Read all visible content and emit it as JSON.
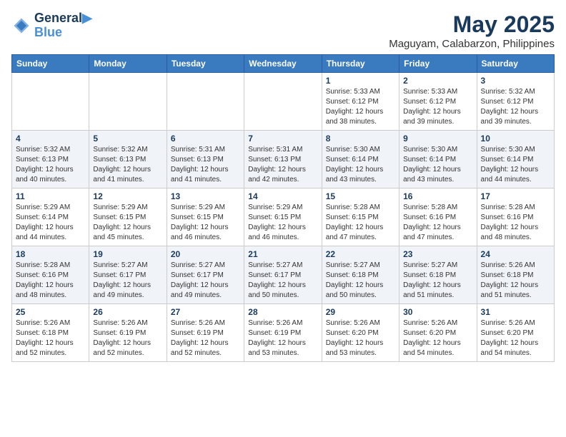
{
  "header": {
    "logo_line1": "General",
    "logo_line2": "Blue",
    "title": "May 2025",
    "subtitle": "Maguyam, Calabarzon, Philippines"
  },
  "columns": [
    "Sunday",
    "Monday",
    "Tuesday",
    "Wednesday",
    "Thursday",
    "Friday",
    "Saturday"
  ],
  "weeks": [
    [
      {
        "day": "",
        "info": ""
      },
      {
        "day": "",
        "info": ""
      },
      {
        "day": "",
        "info": ""
      },
      {
        "day": "",
        "info": ""
      },
      {
        "day": "1",
        "info": "Sunrise: 5:33 AM\nSunset: 6:12 PM\nDaylight: 12 hours\nand 38 minutes."
      },
      {
        "day": "2",
        "info": "Sunrise: 5:33 AM\nSunset: 6:12 PM\nDaylight: 12 hours\nand 39 minutes."
      },
      {
        "day": "3",
        "info": "Sunrise: 5:32 AM\nSunset: 6:12 PM\nDaylight: 12 hours\nand 39 minutes."
      }
    ],
    [
      {
        "day": "4",
        "info": "Sunrise: 5:32 AM\nSunset: 6:13 PM\nDaylight: 12 hours\nand 40 minutes."
      },
      {
        "day": "5",
        "info": "Sunrise: 5:32 AM\nSunset: 6:13 PM\nDaylight: 12 hours\nand 41 minutes."
      },
      {
        "day": "6",
        "info": "Sunrise: 5:31 AM\nSunset: 6:13 PM\nDaylight: 12 hours\nand 41 minutes."
      },
      {
        "day": "7",
        "info": "Sunrise: 5:31 AM\nSunset: 6:13 PM\nDaylight: 12 hours\nand 42 minutes."
      },
      {
        "day": "8",
        "info": "Sunrise: 5:30 AM\nSunset: 6:14 PM\nDaylight: 12 hours\nand 43 minutes."
      },
      {
        "day": "9",
        "info": "Sunrise: 5:30 AM\nSunset: 6:14 PM\nDaylight: 12 hours\nand 43 minutes."
      },
      {
        "day": "10",
        "info": "Sunrise: 5:30 AM\nSunset: 6:14 PM\nDaylight: 12 hours\nand 44 minutes."
      }
    ],
    [
      {
        "day": "11",
        "info": "Sunrise: 5:29 AM\nSunset: 6:14 PM\nDaylight: 12 hours\nand 44 minutes."
      },
      {
        "day": "12",
        "info": "Sunrise: 5:29 AM\nSunset: 6:15 PM\nDaylight: 12 hours\nand 45 minutes."
      },
      {
        "day": "13",
        "info": "Sunrise: 5:29 AM\nSunset: 6:15 PM\nDaylight: 12 hours\nand 46 minutes."
      },
      {
        "day": "14",
        "info": "Sunrise: 5:29 AM\nSunset: 6:15 PM\nDaylight: 12 hours\nand 46 minutes."
      },
      {
        "day": "15",
        "info": "Sunrise: 5:28 AM\nSunset: 6:15 PM\nDaylight: 12 hours\nand 47 minutes."
      },
      {
        "day": "16",
        "info": "Sunrise: 5:28 AM\nSunset: 6:16 PM\nDaylight: 12 hours\nand 47 minutes."
      },
      {
        "day": "17",
        "info": "Sunrise: 5:28 AM\nSunset: 6:16 PM\nDaylight: 12 hours\nand 48 minutes."
      }
    ],
    [
      {
        "day": "18",
        "info": "Sunrise: 5:28 AM\nSunset: 6:16 PM\nDaylight: 12 hours\nand 48 minutes."
      },
      {
        "day": "19",
        "info": "Sunrise: 5:27 AM\nSunset: 6:17 PM\nDaylight: 12 hours\nand 49 minutes."
      },
      {
        "day": "20",
        "info": "Sunrise: 5:27 AM\nSunset: 6:17 PM\nDaylight: 12 hours\nand 49 minutes."
      },
      {
        "day": "21",
        "info": "Sunrise: 5:27 AM\nSunset: 6:17 PM\nDaylight: 12 hours\nand 50 minutes."
      },
      {
        "day": "22",
        "info": "Sunrise: 5:27 AM\nSunset: 6:18 PM\nDaylight: 12 hours\nand 50 minutes."
      },
      {
        "day": "23",
        "info": "Sunrise: 5:27 AM\nSunset: 6:18 PM\nDaylight: 12 hours\nand 51 minutes."
      },
      {
        "day": "24",
        "info": "Sunrise: 5:26 AM\nSunset: 6:18 PM\nDaylight: 12 hours\nand 51 minutes."
      }
    ],
    [
      {
        "day": "25",
        "info": "Sunrise: 5:26 AM\nSunset: 6:18 PM\nDaylight: 12 hours\nand 52 minutes."
      },
      {
        "day": "26",
        "info": "Sunrise: 5:26 AM\nSunset: 6:19 PM\nDaylight: 12 hours\nand 52 minutes."
      },
      {
        "day": "27",
        "info": "Sunrise: 5:26 AM\nSunset: 6:19 PM\nDaylight: 12 hours\nand 52 minutes."
      },
      {
        "day": "28",
        "info": "Sunrise: 5:26 AM\nSunset: 6:19 PM\nDaylight: 12 hours\nand 53 minutes."
      },
      {
        "day": "29",
        "info": "Sunrise: 5:26 AM\nSunset: 6:20 PM\nDaylight: 12 hours\nand 53 minutes."
      },
      {
        "day": "30",
        "info": "Sunrise: 5:26 AM\nSunset: 6:20 PM\nDaylight: 12 hours\nand 54 minutes."
      },
      {
        "day": "31",
        "info": "Sunrise: 5:26 AM\nSunset: 6:20 PM\nDaylight: 12 hours\nand 54 minutes."
      }
    ]
  ]
}
